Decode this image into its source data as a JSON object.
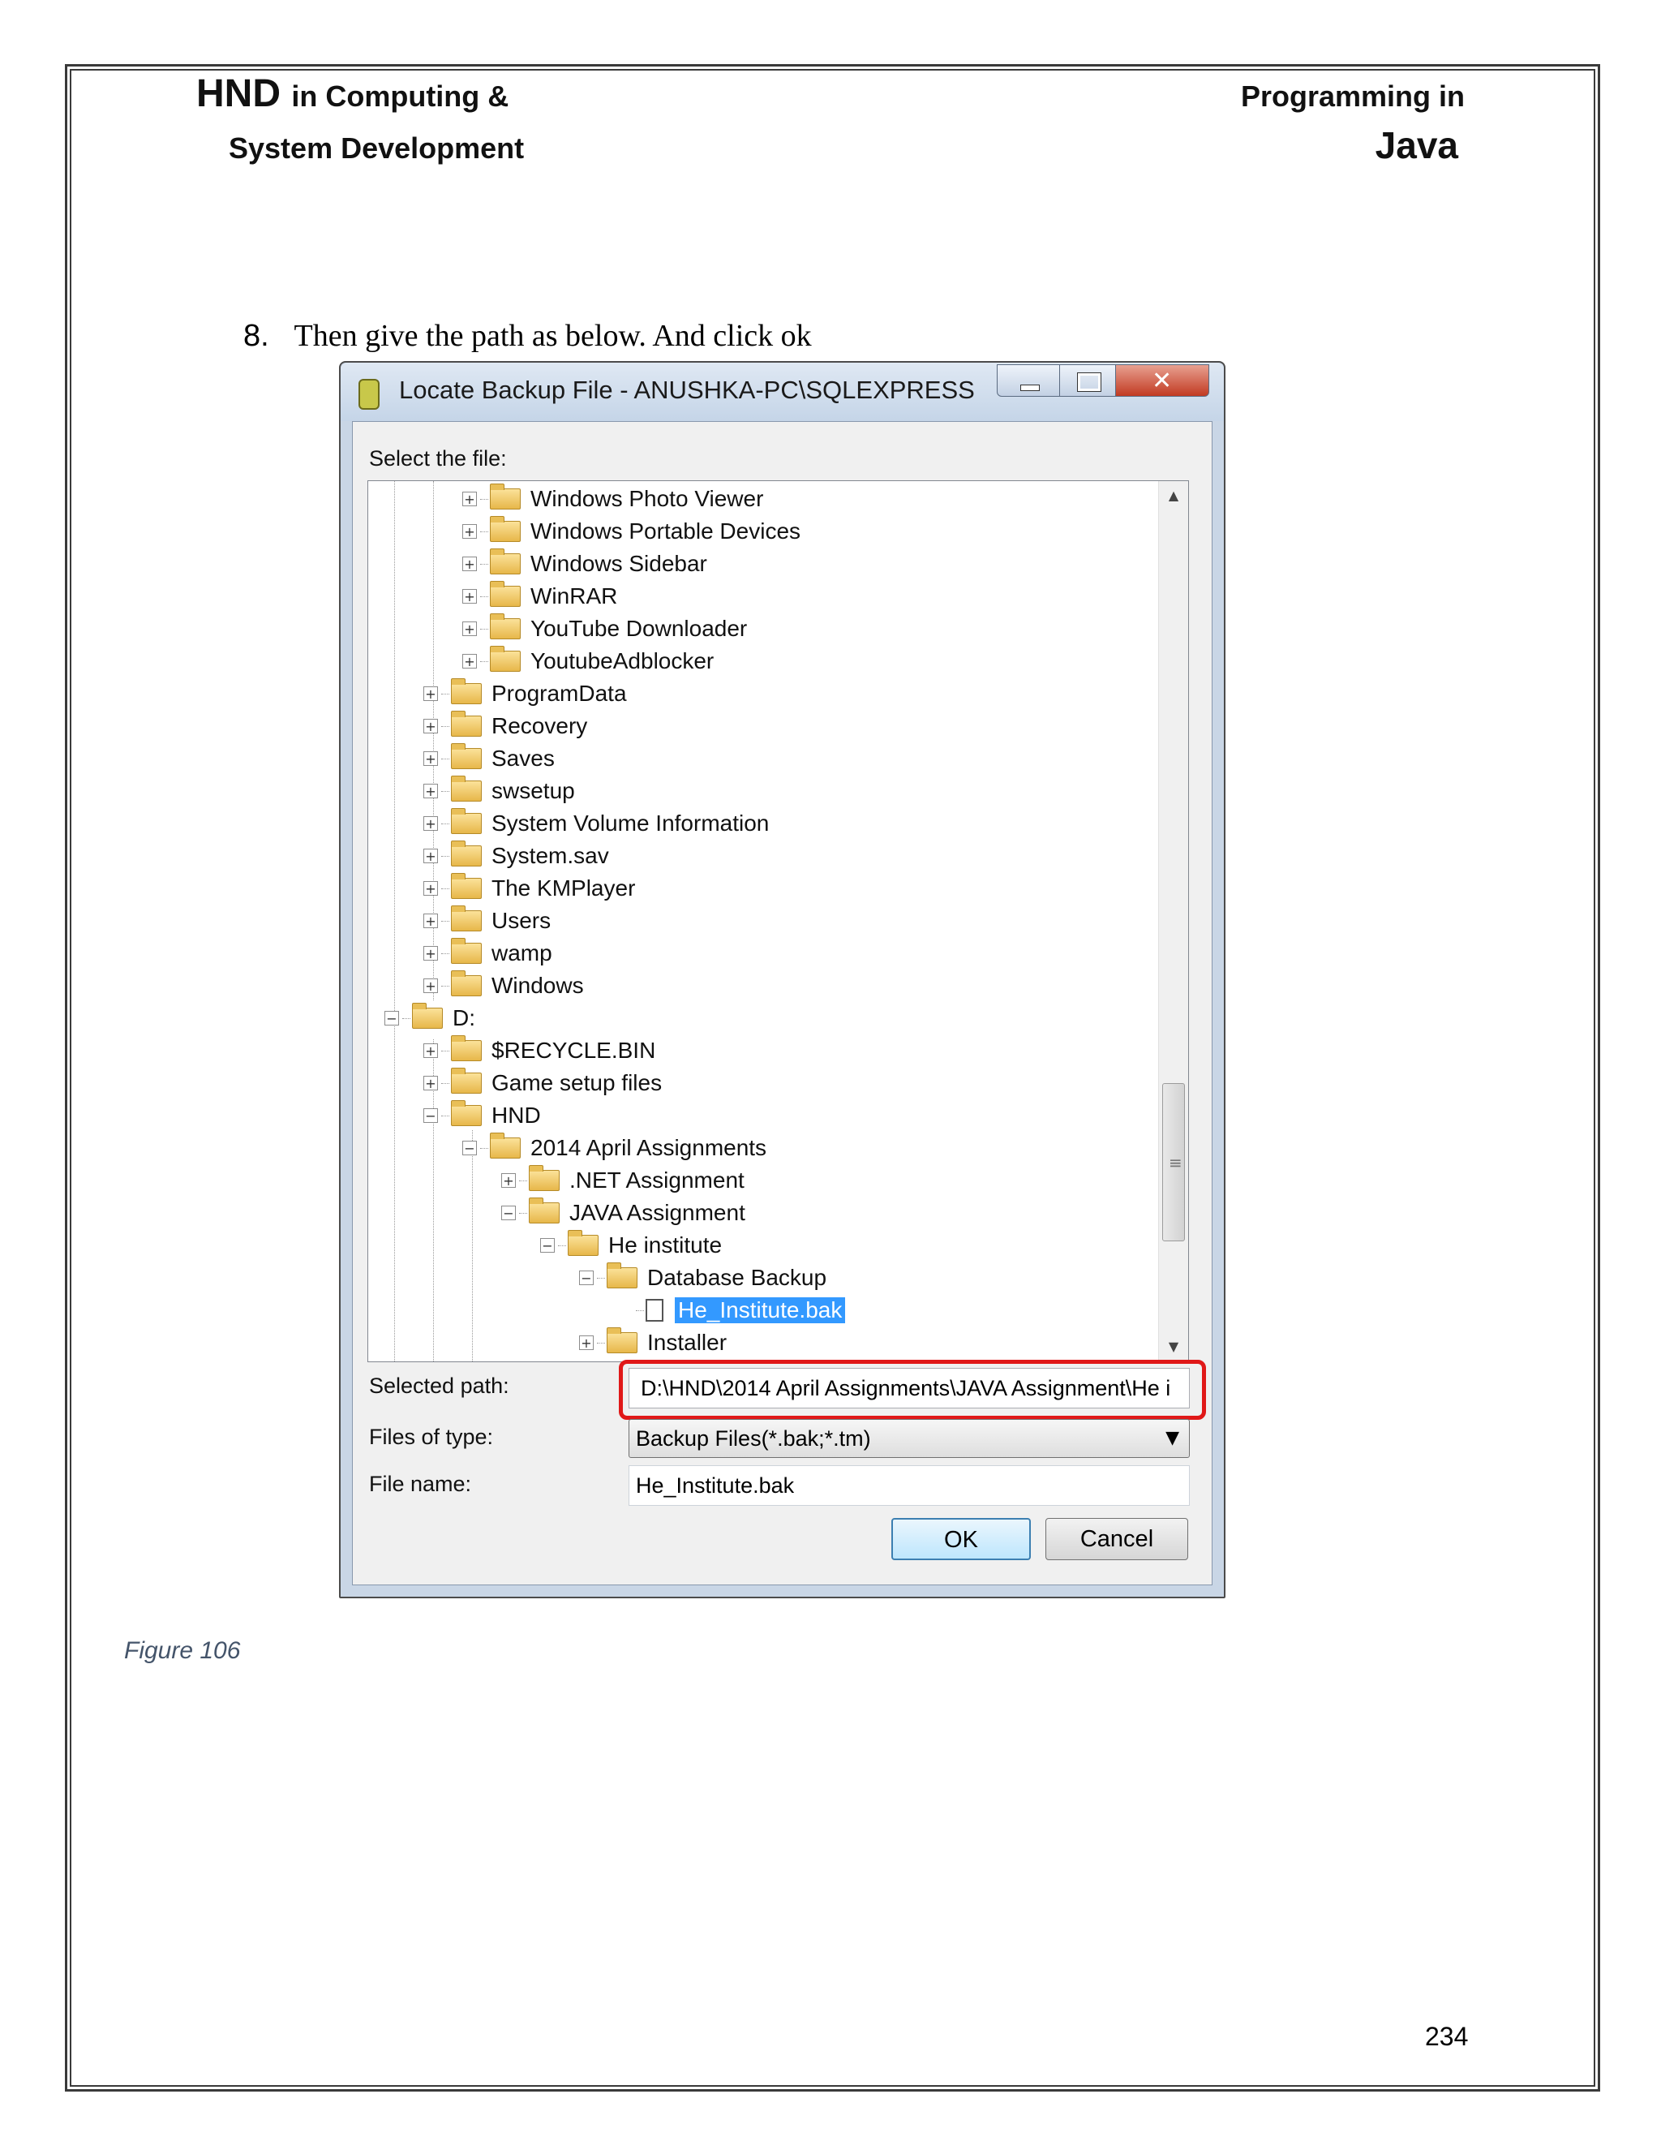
{
  "header": {
    "left_line1_hnd": "HND",
    "left_line1_rest": "in Computing &",
    "left_line2": "System Development",
    "right_line1": "Programming in",
    "right_line2": "Java"
  },
  "step": {
    "number": "8.",
    "text": "Then  give the path as below. And click ok"
  },
  "dialog": {
    "title": "Locate Backup File - ANUSHKA-PC\\SQLEXPRESS",
    "select_label": "Select the file:",
    "tree_items": [
      {
        "label": "Windows Photo Viewer",
        "expander": "+",
        "selected": false
      },
      {
        "label": "Windows Portable Devices",
        "expander": "+",
        "selected": false
      },
      {
        "label": "Windows Sidebar",
        "expander": "+",
        "selected": false
      },
      {
        "label": "WinRAR",
        "expander": "+",
        "selected": false
      },
      {
        "label": "YouTube Downloader",
        "expander": "+",
        "selected": false
      },
      {
        "label": "YoutubeAdblocker",
        "expander": "+",
        "selected": false
      },
      {
        "label": "ProgramData",
        "expander": "+",
        "selected": false
      },
      {
        "label": "Recovery",
        "expander": "+",
        "selected": false
      },
      {
        "label": "Saves",
        "expander": "+",
        "selected": false
      },
      {
        "label": "swsetup",
        "expander": "+",
        "selected": false
      },
      {
        "label": "System Volume Information",
        "expander": "+",
        "selected": false
      },
      {
        "label": "System.sav",
        "expander": "+",
        "selected": false
      },
      {
        "label": "The KMPlayer",
        "expander": "+",
        "selected": false
      },
      {
        "label": "Users",
        "expander": "+",
        "selected": false
      },
      {
        "label": "wamp",
        "expander": "+",
        "selected": false
      },
      {
        "label": "Windows",
        "expander": "+",
        "selected": false
      },
      {
        "label": "D:",
        "expander": "−",
        "selected": false
      },
      {
        "label": "$RECYCLE.BIN",
        "expander": "+",
        "selected": false
      },
      {
        "label": "Game setup files",
        "expander": "+",
        "selected": false
      },
      {
        "label": "HND",
        "expander": "−",
        "selected": false
      },
      {
        "label": "2014 April Assignments",
        "expander": "−",
        "selected": false
      },
      {
        "label": ".NET Assignment",
        "expander": "+",
        "selected": false
      },
      {
        "label": "JAVA Assignment",
        "expander": "−",
        "selected": false
      },
      {
        "label": "He institute",
        "expander": "−",
        "selected": false
      },
      {
        "label": "Database Backup",
        "expander": "−",
        "selected": false
      },
      {
        "label": "He_Institute.bak",
        "expander": "",
        "selected": true
      },
      {
        "label": "Installer",
        "expander": "+",
        "selected": false
      }
    ],
    "selected_path_label": "Selected path:",
    "selected_path_value": "D:\\HND\\2014 April Assignments\\JAVA Assignment\\He i",
    "files_of_type_label": "Files of type:",
    "files_of_type_value": "Backup Files(*.bak;*.tm)",
    "file_name_label": "File name:",
    "file_name_value": "He_Institute.bak",
    "ok_label": "OK",
    "cancel_label": "Cancel"
  },
  "caption": "Figure 106",
  "page_number": "234"
}
